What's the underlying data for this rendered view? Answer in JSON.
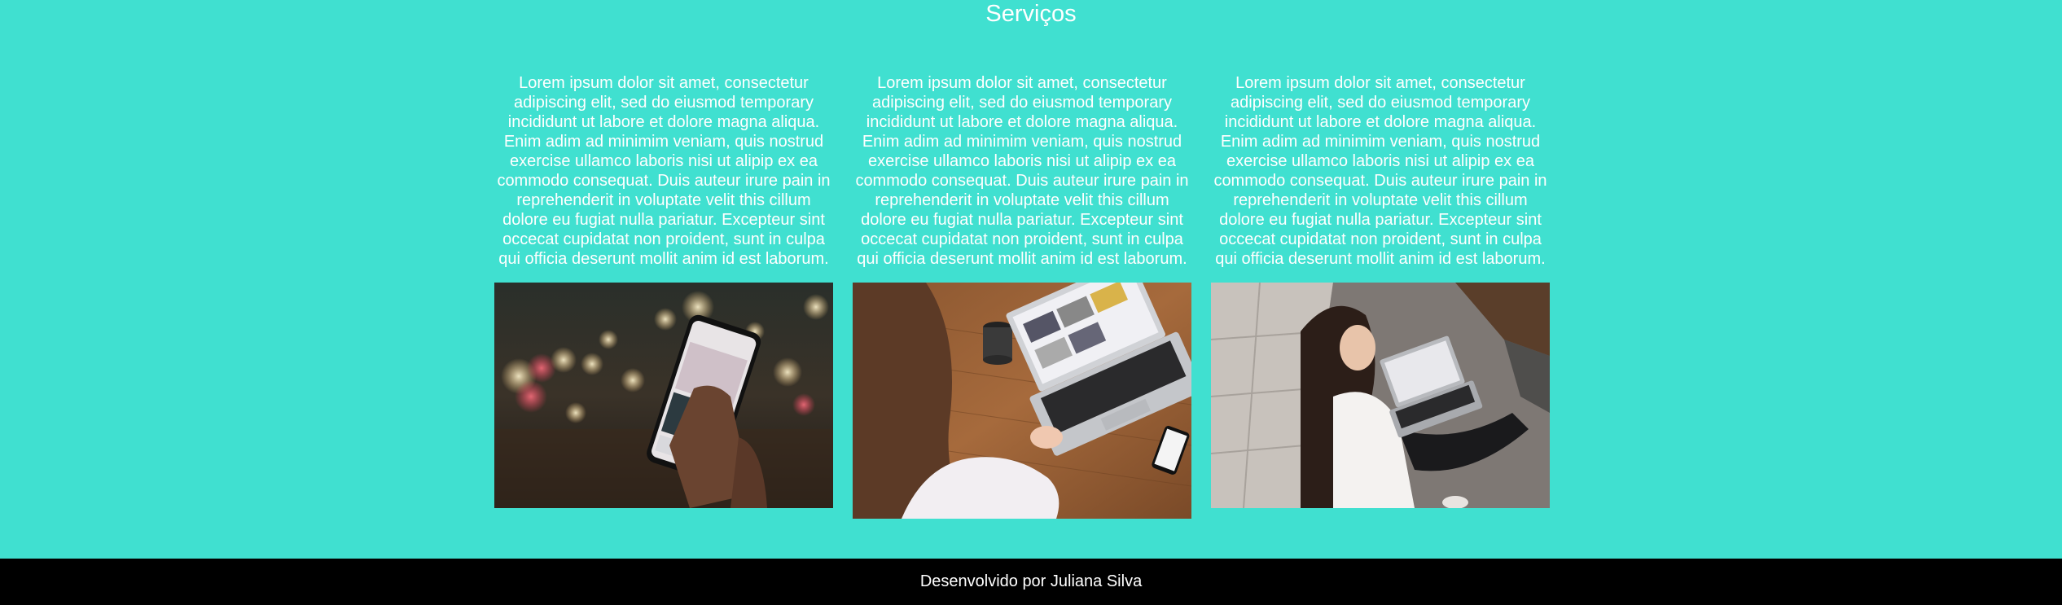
{
  "section": {
    "title": "Serviços"
  },
  "services": [
    {
      "text": "Lorem ipsum dolor sit amet, consectetur adipiscing elit, sed do eiusmod temporary incididunt ut labore et dolore magna aliqua. Enim adim ad minimim veniam, quis nostrud exercise ullamco laboris nisi ut alipip ex ea commodo consequat. Duis auteur irure pain in reprehenderit in voluptate velit this cillum dolore eu fugiat nulla pariatur. Excepteur sint occecat cupidatat non proident, sunt in culpa qui officia deserunt mollit anim id est laborum.",
      "image": "phone-photo"
    },
    {
      "text": "Lorem ipsum dolor sit amet, consectetur adipiscing elit, sed do eiusmod temporary incididunt ut labore et dolore magna aliqua. Enim adim ad minimim veniam, quis nostrud exercise ullamco laboris nisi ut alipip ex ea commodo consequat. Duis auteur irure pain in reprehenderit in voluptate velit this cillum dolore eu fugiat nulla pariatur. Excepteur sint occecat cupidatat non proident, sunt in culpa qui officia deserunt mollit anim id est laborum.",
      "image": "laptop-desk-photo"
    },
    {
      "text": "Lorem ipsum dolor sit amet, consectetur adipiscing elit, sed do eiusmod temporary incididunt ut labore et dolore magna aliqua. Enim adim ad minimim veniam, quis nostrud exercise ullamco laboris nisi ut alipip ex ea commodo consequat. Duis auteur irure pain in reprehenderit in voluptate velit this cillum dolore eu fugiat nulla pariatur. Excepteur sint occecat cupidatat non proident, sunt in culpa qui officia deserunt mollit anim id est laborum.",
      "image": "laptop-couch-photo"
    }
  ],
  "footer": {
    "text": "Desenvolvido por Juliana Silva"
  },
  "colors": {
    "background": "#40e0d0",
    "text": "#ffffff",
    "footer_background": "#000000"
  }
}
